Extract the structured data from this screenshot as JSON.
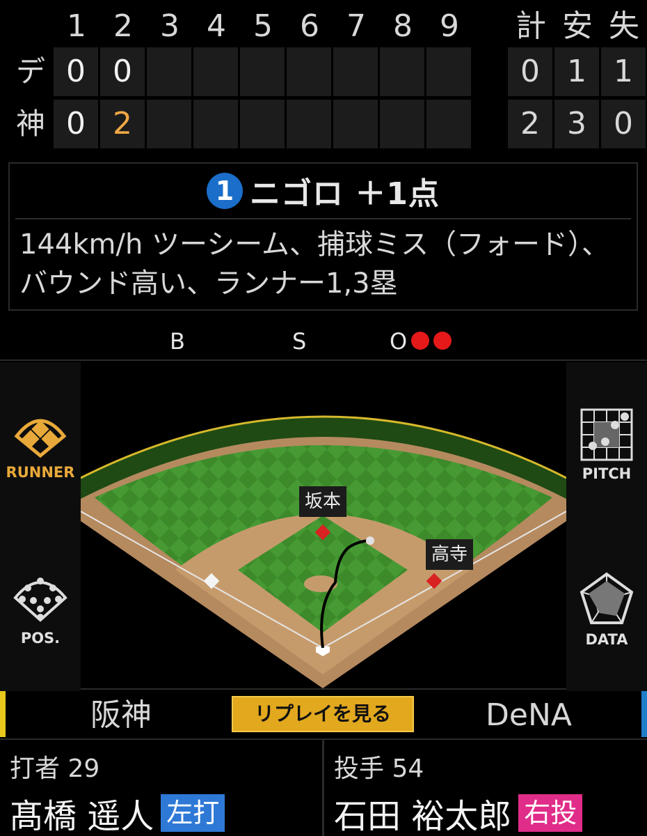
{
  "scoreboard": {
    "innings": [
      "1",
      "2",
      "3",
      "4",
      "5",
      "6",
      "7",
      "8",
      "9"
    ],
    "totals_headers": [
      "計",
      "安",
      "失"
    ],
    "rows": [
      {
        "team": "デ",
        "scores": [
          "0",
          "0",
          "",
          "",
          "",
          "",
          "",
          "",
          ""
        ],
        "totals": [
          "0",
          "1",
          "1"
        ]
      },
      {
        "team": "神",
        "scores": [
          "0",
          "2",
          "",
          "",
          "",
          "",
          "",
          "",
          ""
        ],
        "totals": [
          "2",
          "3",
          "0"
        ]
      }
    ]
  },
  "play": {
    "badge": "1",
    "title": "ニゴロ ＋1点",
    "description": "144km/h ツーシーム、捕球ミス（フォード）、バウンド高い、ランナー1,3塁"
  },
  "count": {
    "balls_label": "B",
    "strikes_label": "S",
    "outs_label": "O",
    "outs": 2,
    "out_color": "#e51919"
  },
  "side_buttons": {
    "runner": "RUNNER",
    "pitch": "PITCH",
    "pos": "POS.",
    "data": "DATA"
  },
  "field": {
    "runner_labels": {
      "second": "坂本",
      "first": "高寺"
    }
  },
  "teams": {
    "home": "阪神",
    "away": "DeNA",
    "replay_button": "リプレイを見る",
    "home_color": "#e8c81c",
    "away_color": "#1f7ec9"
  },
  "batter": {
    "role": "打者 29",
    "name": "髙橋 遥人",
    "hand": "左打"
  },
  "pitcher": {
    "role": "投手 54",
    "name": "石田 裕太郎",
    "hand": "右投"
  },
  "colors": {
    "accent": "#e9a93a",
    "badge_blue": "#1b6ec9",
    "replay_bg": "#e2a81e"
  }
}
